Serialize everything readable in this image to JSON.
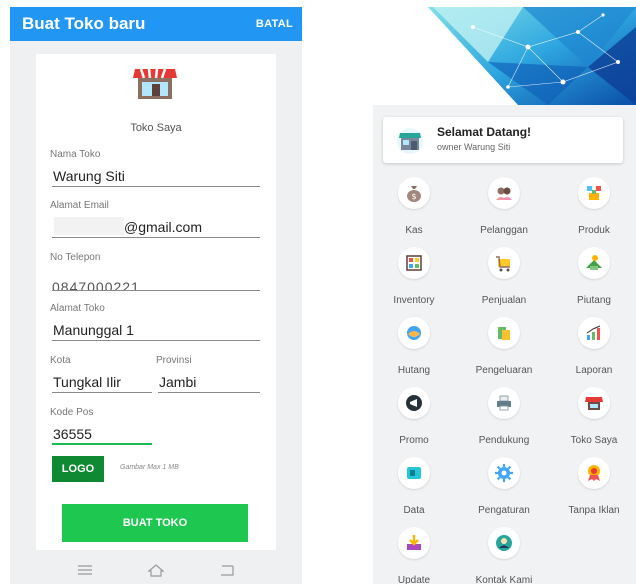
{
  "left_screen": {
    "appbar": {
      "title": "Buat Toko baru",
      "action": "BATAL"
    },
    "form": {
      "store_name": "Toko Saya",
      "nama_toko": {
        "label": "Nama Toko",
        "value": "Warung Siti"
      },
      "email": {
        "label": "Alamat Email",
        "value": "@gmail.com"
      },
      "telepon": {
        "label": "No Telepon",
        "value": "0847000221"
      },
      "alamat": {
        "label": "Alamat Toko",
        "value": "Manunggal 1"
      },
      "kota": {
        "label": "Kota",
        "value": "Tungkal Ilir"
      },
      "provinsi": {
        "label": "Provinsi",
        "value": "Jambi"
      },
      "kode_pos": {
        "label": "Kode Pos",
        "value": "36555"
      },
      "logo_button": "LOGO",
      "logo_hint": "Gambar Max 1 MB",
      "submit_button": "BUAT TOKO"
    },
    "navbar": [
      "menu-icon",
      "home-icon",
      "back-icon"
    ]
  },
  "right_screen": {
    "welcome": {
      "title": "Selamat Datang!",
      "subtitle": "owner Warung Siti"
    },
    "menu": [
      {
        "label": "Kas",
        "icon": "money-bag-icon"
      },
      {
        "label": "Pelanggan",
        "icon": "customers-icon"
      },
      {
        "label": "Produk",
        "icon": "products-icon"
      },
      {
        "label": "Inventory",
        "icon": "inventory-icon"
      },
      {
        "label": "Penjualan",
        "icon": "cart-icon"
      },
      {
        "label": "Piutang",
        "icon": "receivable-icon"
      },
      {
        "label": "Hutang",
        "icon": "debt-icon"
      },
      {
        "label": "Pengeluaran",
        "icon": "expense-icon"
      },
      {
        "label": "Laporan",
        "icon": "report-chart-icon"
      },
      {
        "label": "Promo",
        "icon": "megaphone-icon"
      },
      {
        "label": "Pendukung",
        "icon": "printer-icon"
      },
      {
        "label": "Toko Saya",
        "icon": "store-icon"
      },
      {
        "label": "Data",
        "icon": "data-icon"
      },
      {
        "label": "Pengaturan",
        "icon": "gear-icon"
      },
      {
        "label": "Tanpa Iklan",
        "icon": "badge-icon"
      },
      {
        "label": "Update",
        "icon": "download-icon"
      },
      {
        "label": "Kontak Kami",
        "icon": "contact-icon"
      }
    ]
  },
  "colors": {
    "appbar": "#2196f3",
    "logo_button": "#0f8a32",
    "submit_button": "#1ec750",
    "focus_underline": "#1db954"
  }
}
